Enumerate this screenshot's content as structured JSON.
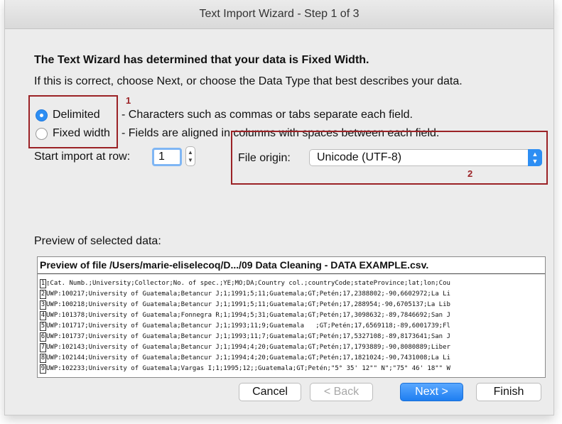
{
  "window": {
    "title": "Text Import Wizard - Step 1 of 3"
  },
  "intro": {
    "heading": "The Text Wizard has determined that your data is Fixed Width.",
    "text": "If this is correct, choose Next, or choose the Data Type that best describes your data."
  },
  "data_type": {
    "options": [
      {
        "label": "Delimited",
        "description": "- Characters such as commas or tabs separate each field.",
        "selected": true
      },
      {
        "label": "Fixed width",
        "description": "- Fields are aligned in columns with spaces between each field.",
        "selected": false
      }
    ]
  },
  "annotations": {
    "one": "1",
    "two": "2",
    "color": "#9b2226"
  },
  "start_row": {
    "label": "Start import at row:",
    "value": "1"
  },
  "file_origin": {
    "label": "File origin:",
    "value": "Unicode (UTF-8)"
  },
  "preview": {
    "label": "Preview of selected data:",
    "header": "Preview of file /Users/marie-eliselecoq/D.../09 Data Cleaning - DATA EXAMPLE.csv.",
    "lines": [
      {
        "n": "1",
        "text": "▯Cat. Numb.;University;Collector;No. of spec.;YE;MO;DA;Country col.;countryCode;stateProvince;lat;lon;Cou"
      },
      {
        "n": "2",
        "text": "UWP:100217;University of Guatemala;Betancur J;1;1991;5;11;Guatemala;GT;Petén;17,2388802;-90,6602972;La Li"
      },
      {
        "n": "3",
        "text": "UWP:100218;University of Guatemala;Betancur J;1;1991;5;11;Guatemala;GT;Petén;17,288954;-90,6705137;La Lib"
      },
      {
        "n": "4",
        "text": "UWP:101378;University of Guatemala;Fonnegra R;1;1994;5;31;Guatemala;GT;Petén;17,3098632;-89,7846692;San J"
      },
      {
        "n": "5",
        "text": "UWP:101717;University of Guatemala;Betancur J;1;1993;11;9;Guatemala   ;GT;Petén;17,6569118;-89,6001739;Fl"
      },
      {
        "n": "6",
        "text": "UWP:101737;University of Guatemala;Betancur J;1;1993;11;7;Guatemala;GT;Petén;17,5327108;-89,8173641;San J"
      },
      {
        "n": "7",
        "text": "UWP:102143;University of Guatemala;Betancur J;1;1994;4;20;Guatemala;GT;Petén;17,1793889;-90,8080889;Liber"
      },
      {
        "n": "8",
        "text": "UWP:102144;University of Guatemala;Betancur J;1;1994;4;20;Guatemala;GT;Petén;17,1821024;-90,7431008;La Li"
      },
      {
        "n": "9",
        "text": "UWP:102233;University of Guatemala;Vargas I;1;1995;12;;Guatemala;GT;Petén;\"5° 35' 12\"\" N\";\"75° 46' 18\"\" W"
      }
    ]
  },
  "buttons": {
    "cancel": "Cancel",
    "back": "< Back",
    "next": "Next >",
    "finish": "Finish"
  }
}
